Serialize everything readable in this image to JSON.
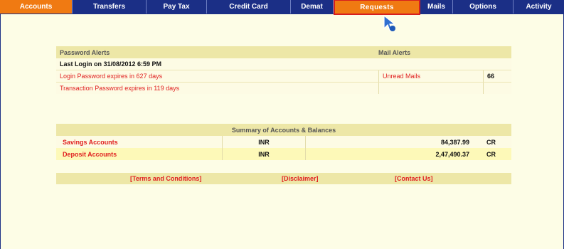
{
  "nav": {
    "tabs": [
      {
        "label": "Accounts"
      },
      {
        "label": "Transfers"
      },
      {
        "label": "Pay Tax"
      },
      {
        "label": "Credit Card"
      },
      {
        "label": "Demat"
      },
      {
        "label": "Requests"
      },
      {
        "label": "Mails"
      },
      {
        "label": "Options"
      },
      {
        "label": "Activity"
      }
    ],
    "active_tab": "Accounts",
    "hovered_tab": "Requests"
  },
  "alerts": {
    "password_header": "Password Alerts",
    "mail_header": "Mail Alerts",
    "last_login": "Last Login on 31/08/2012 6:59 PM",
    "login_expiry": "Login Password expires in 627 days",
    "transaction_expiry": "Transaction Password expires in 119 days",
    "unread_label": "Unread Mails",
    "unread_count": "66"
  },
  "summary": {
    "header": "Summary of Accounts & Balances",
    "rows": [
      {
        "name": "Savings Accounts",
        "currency": "INR",
        "balance": "84,387.99",
        "type": "CR"
      },
      {
        "name": "Deposit Accounts",
        "currency": "INR",
        "balance": "2,47,490.37",
        "type": "CR"
      }
    ]
  },
  "footer": {
    "terms": "[Terms and Conditions]",
    "disclaimer": "[Disclaimer]",
    "contact": "[Contact Us]"
  },
  "colors": {
    "nav_bg": "#1b2f86",
    "active_tab": "#f07a12",
    "page_bg": "#fdfde6",
    "header_bg": "#ede7a7",
    "alert_text": "#e02020"
  }
}
